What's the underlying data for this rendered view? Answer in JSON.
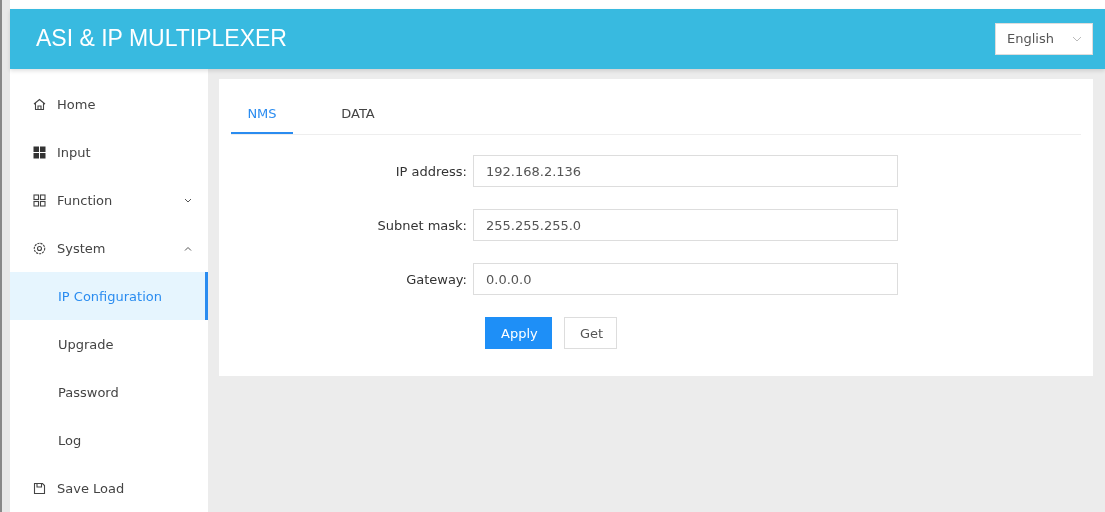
{
  "header": {
    "title": "ASI & IP MULTIPLEXER",
    "language": "English"
  },
  "sidebar": {
    "items": [
      {
        "label": "Home",
        "selected": false
      },
      {
        "label": "Input",
        "selected": false
      },
      {
        "label": "Function",
        "selected": false,
        "expanded": false
      },
      {
        "label": "System",
        "selected": false,
        "expanded": true,
        "children": [
          {
            "label": "IP Configuration",
            "selected": true
          },
          {
            "label": "Upgrade",
            "selected": false
          },
          {
            "label": "Password",
            "selected": false
          },
          {
            "label": "Log",
            "selected": false
          }
        ]
      },
      {
        "label": "Save Load",
        "selected": false
      }
    ]
  },
  "tabs": [
    {
      "label": "NMS",
      "selected": true
    },
    {
      "label": "DATA",
      "selected": false
    }
  ],
  "form": {
    "fields": [
      {
        "label": "IP address:",
        "value": "192.168.2.136"
      },
      {
        "label": "Subnet mask:",
        "value": "255.255.255.0"
      },
      {
        "label": "Gateway:",
        "value": "0.0.0.0"
      }
    ],
    "buttons": [
      {
        "label": "Apply",
        "kind": "primary"
      },
      {
        "label": "Get",
        "kind": "default"
      }
    ]
  }
}
